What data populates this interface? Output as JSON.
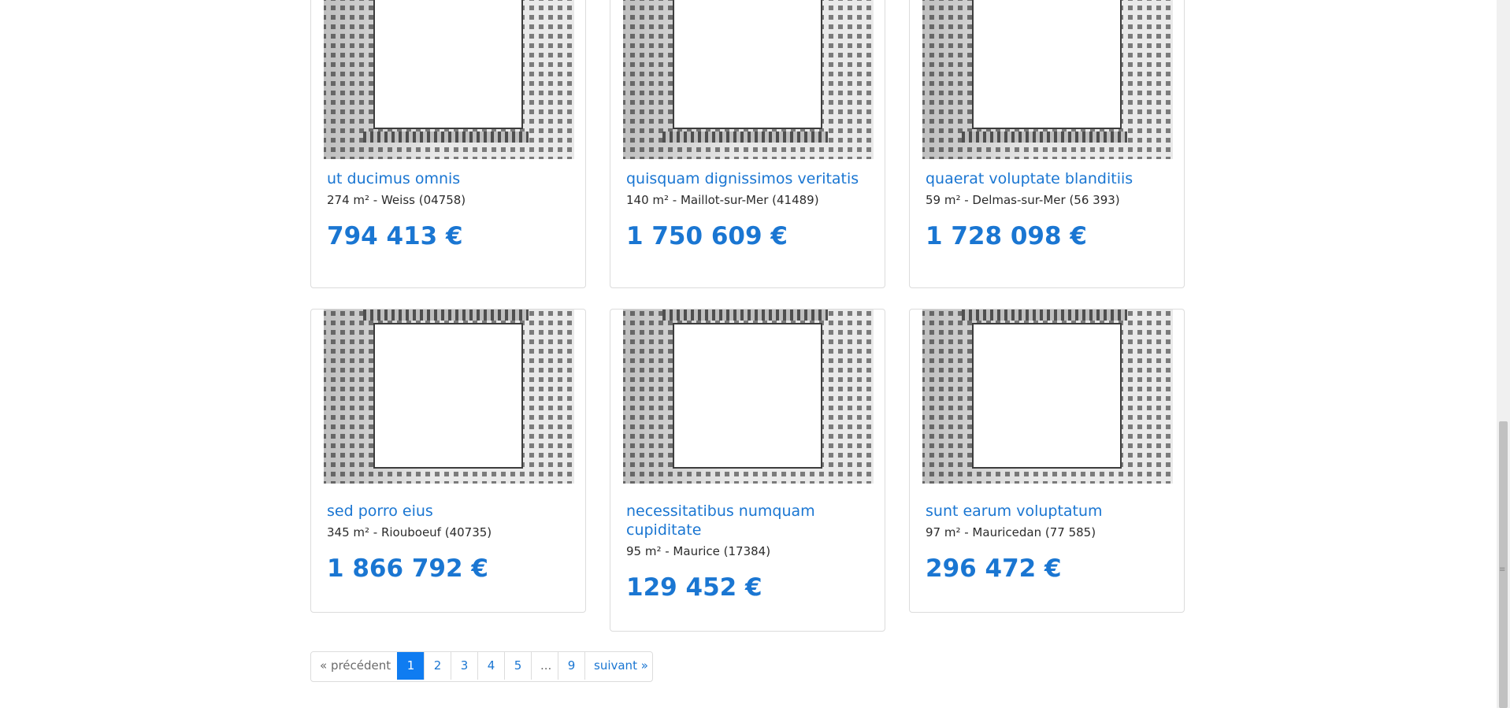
{
  "listings": [
    {
      "title": "ut ducimus omnis",
      "meta": "274 m² - Weiss (04758)",
      "price": "794 413 €"
    },
    {
      "title": "quisquam dignissimos veritatis",
      "meta": "140 m² - Maillot-sur-Mer (41489)",
      "price": "1 750 609 €"
    },
    {
      "title": "quaerat voluptate blanditiis",
      "meta": "59 m² - Delmas-sur-Mer (56 393)",
      "price": "1 728 098 €"
    },
    {
      "title": "sed porro eius",
      "meta": "345 m² - Riouboeuf (40735)",
      "price": "1 866 792 €"
    },
    {
      "title": "necessitatibus numquam cupiditate",
      "meta": "95 m² - Maurice (17384)",
      "price": "129 452 €"
    },
    {
      "title": "sunt earum voluptatum",
      "meta": "97 m² - Mauricedan (77 585)",
      "price": "296 472 €"
    }
  ],
  "pagination": {
    "prev": "« précédent",
    "pages": [
      "1",
      "2",
      "3",
      "4",
      "5",
      "...",
      "9"
    ],
    "current": "1",
    "next": "suivant »"
  },
  "colors": {
    "accent": "#1a76d2",
    "active_page": "#0f7cf1"
  }
}
